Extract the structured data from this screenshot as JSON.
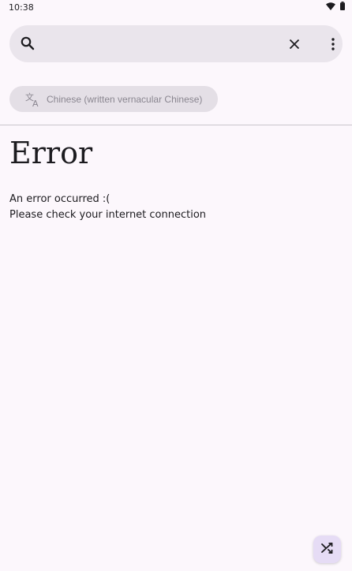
{
  "status_bar": {
    "time": "10:38",
    "icons": [
      "wifi-icon",
      "battery-icon"
    ]
  },
  "search": {
    "value": "",
    "placeholder": "",
    "icons": [
      "search-icon",
      "close-icon",
      "more-vert-icon"
    ]
  },
  "language_chip": {
    "label": "Chinese (written vernacular Chinese)",
    "icon": "translate-icon"
  },
  "content": {
    "title": "Error",
    "message_line1": "An error occurred :(",
    "message_line2": "Please check your internet connection"
  },
  "fab": {
    "icon": "shuffle-icon"
  },
  "colors": {
    "background": "#fcf7fc",
    "search_bar": "#eae5ec",
    "chip": "#e4dfe6",
    "fab": "#e6dcf5",
    "text": "#1c1b1f",
    "muted_text": "#8a8690"
  }
}
